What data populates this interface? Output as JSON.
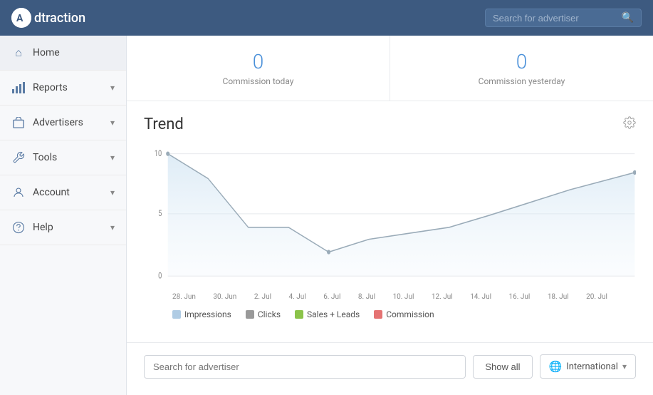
{
  "header": {
    "logo_icon": "A",
    "logo_text": "dtraction",
    "search_placeholder": "Search for advertiser"
  },
  "sidebar": {
    "items": [
      {
        "id": "home",
        "label": "Home",
        "icon": "⌂",
        "active": true,
        "has_chevron": false
      },
      {
        "id": "reports",
        "label": "Reports",
        "icon": "📊",
        "active": false,
        "has_chevron": true
      },
      {
        "id": "advertisers",
        "label": "Advertisers",
        "icon": "🛒",
        "active": false,
        "has_chevron": true
      },
      {
        "id": "tools",
        "label": "Tools",
        "icon": "🔧",
        "active": false,
        "has_chevron": true
      },
      {
        "id": "account",
        "label": "Account",
        "icon": "👤",
        "active": false,
        "has_chevron": true
      },
      {
        "id": "help",
        "label": "Help",
        "icon": "❓",
        "active": false,
        "has_chevron": true
      }
    ]
  },
  "stats": [
    {
      "id": "commission-today",
      "value": "0",
      "label": "Commission today"
    },
    {
      "id": "commission-yesterday",
      "value": "0",
      "label": "Commission yesterday"
    }
  ],
  "chart": {
    "title": "Trend",
    "y_labels": [
      "10",
      "5",
      "0"
    ],
    "x_labels": [
      "28. Jun",
      "30. Jun",
      "2. Jul",
      "4. Jul",
      "6. Jul",
      "8. Jul",
      "10. Jul",
      "12. Jul",
      "14. Jul",
      "16. Jul",
      "18. Jul",
      "20. Jul"
    ],
    "legend": [
      {
        "id": "impressions",
        "label": "Impressions",
        "color": "#b0cce4"
      },
      {
        "id": "clicks",
        "label": "Clicks",
        "color": "#999"
      },
      {
        "id": "sales-leads",
        "label": "Sales + Leads",
        "color": "#8bc34a"
      },
      {
        "id": "commission",
        "label": "Commission",
        "color": "#e57373"
      }
    ]
  },
  "bottom_toolbar": {
    "search_placeholder": "Search for advertiser",
    "show_all_label": "Show all",
    "international_label": "International"
  }
}
